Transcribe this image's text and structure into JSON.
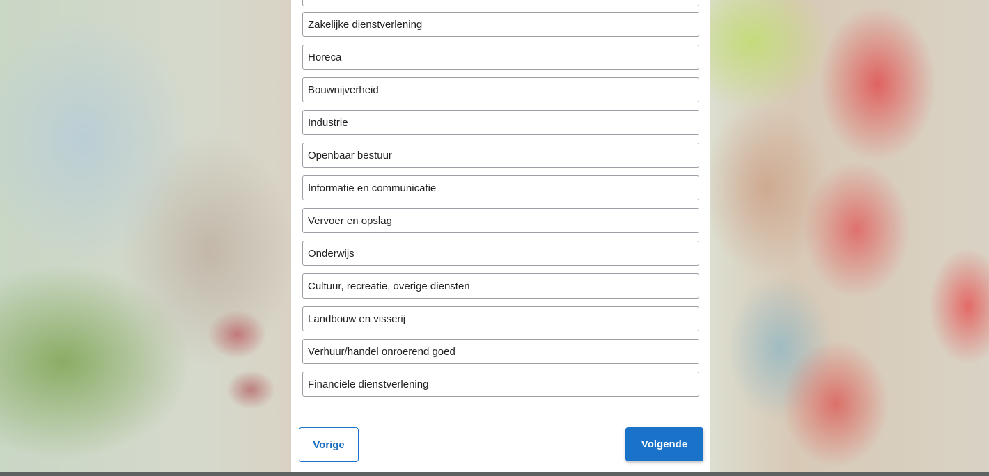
{
  "options": [
    "Zakelijke dienstverlening",
    "Horeca",
    "Bouwnijverheid",
    "Industrie",
    "Openbaar bestuur",
    "Informatie en communicatie",
    "Vervoer en opslag",
    "Onderwijs",
    "Cultuur, recreatie, overige diensten",
    "Landbouw en visserij",
    "Verhuur/handel onroerend goed",
    "Financiële dienstverlening"
  ],
  "nav": {
    "prev_label": "Vorige",
    "next_label": "Volgende"
  },
  "colors": {
    "accent": "#1a73c9",
    "option_border": "#9aa0a6"
  }
}
